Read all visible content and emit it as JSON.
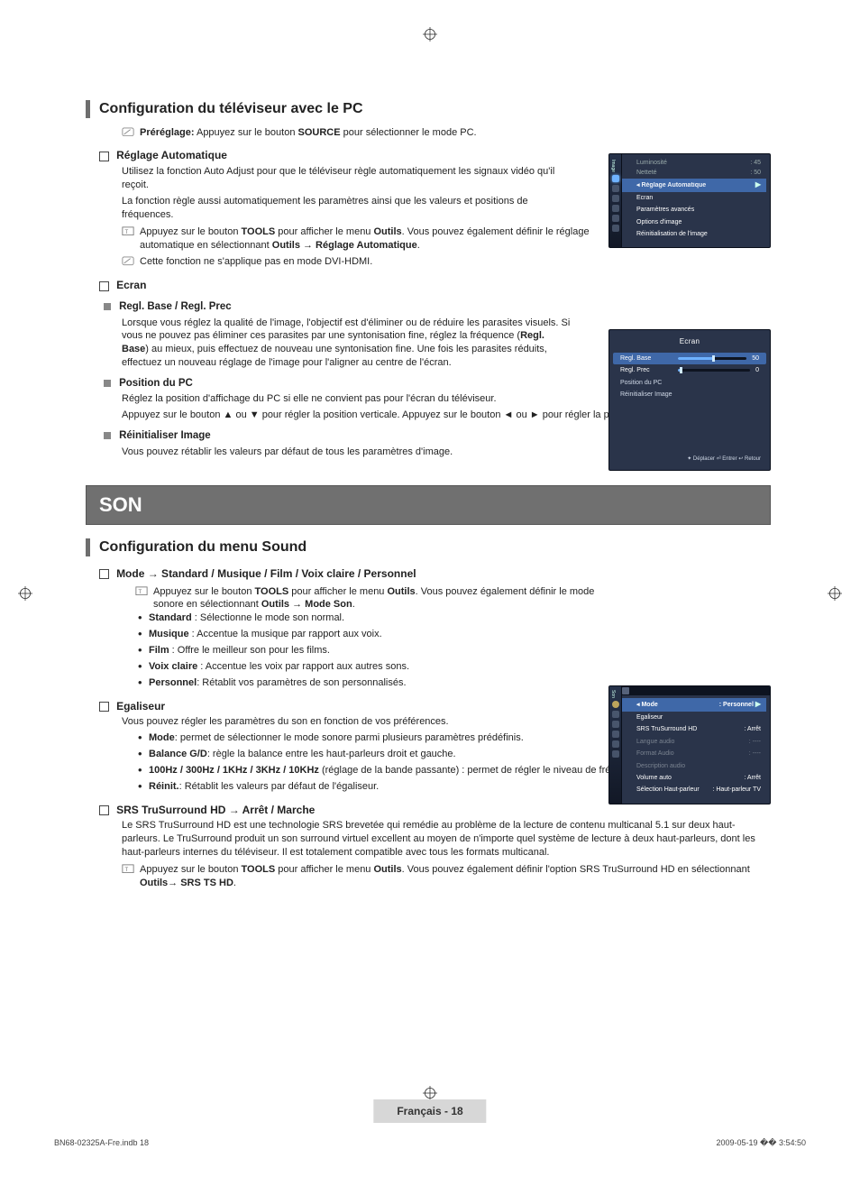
{
  "registration": "⊕",
  "header": {
    "main_title": "Configuration du téléviseur avec le PC",
    "prereg_label": "Préréglage:",
    "prereg_text_a": " Appuyez sur le bouton ",
    "prereg_source": "SOURCE",
    "prereg_text_b": " pour sélectionner le mode PC."
  },
  "reglage_auto": {
    "title": "Réglage Automatique",
    "p1": "Utilisez la fonction Auto Adjust pour que le téléviseur règle automatiquement les signaux vidéo qu'il reçoit.",
    "p2": "La fonction règle aussi automatiquement les paramètres ainsi que les valeurs et positions de fréquences.",
    "tools_a": "Appuyez sur le bouton ",
    "tools_bold1": "TOOLS",
    "tools_b": " pour afficher le menu ",
    "tools_bold2": "Outils",
    "tools_c": ". Vous pouvez également définir le réglage automatique en sélectionnant ",
    "tools_bold3": "Outils → Réglage Automatique",
    "tools_d": ".",
    "note_dvi": "Cette fonction ne s'applique pas en mode DVI-HDMI."
  },
  "ecran": {
    "title": "Ecran",
    "regl": {
      "title": "Regl. Base / Regl. Prec",
      "p_a": "Lorsque vous réglez la qualité de l'image, l'objectif est d'éliminer ou de réduire les parasites visuels. Si vous ne pouvez pas éliminer ces parasites par une syntonisation fine, réglez la fréquence (",
      "p_bold": "Regl. Base",
      "p_b": ") au mieux, puis effectuez de nouveau une syntonisation fine. Une fois les parasites réduits, effectuez un nouveau réglage de l'image pour l'aligner au centre de l'écran."
    },
    "pos": {
      "title": "Position du PC",
      "p1": "Réglez la position d'affichage du PC si elle ne convient pas pour l'écran du téléviseur.",
      "p2": "Appuyez sur le bouton ▲ ou ▼ pour régler la position verticale. Appuyez sur le bouton ◄ ou ► pour régler la position horizontale."
    },
    "reinit": {
      "title": "Réinitialiser Image",
      "p": "Vous pouvez rétablir les valeurs par défaut de tous les paramètres d'image."
    }
  },
  "son_banner": "SON",
  "sound": {
    "title": "Configuration du menu Sound",
    "mode": {
      "title": "Mode → Standard / Musique / Film / Voix claire / Personnel",
      "tools_a": "Appuyez sur le bouton ",
      "tools_bold1": "TOOLS",
      "tools_b": " pour afficher le menu ",
      "tools_bold2": "Outils",
      "tools_c": ". Vous pouvez également définir le mode sonore en sélectionnant ",
      "tools_bold3": "Outils → Mode Son",
      "tools_d": ".",
      "items": [
        {
          "b": "Standard",
          "t": " : Sélectionne le mode son normal."
        },
        {
          "b": "Musique",
          "t": " : Accentue la musique par rapport aux voix."
        },
        {
          "b": "Film",
          "t": " : Offre le meilleur son pour les films."
        },
        {
          "b": "Voix claire",
          "t": " : Accentue les voix par rapport aux autres sons."
        },
        {
          "b": "Personnel",
          "t": ": Rétablit vos paramètres de son personnalisés."
        }
      ]
    },
    "eq": {
      "title": "Egaliseur",
      "p": "Vous pouvez régler les paramètres du son en fonction de vos préférences.",
      "items": [
        {
          "b": "Mode",
          "t": ": permet de sélectionner le mode sonore parmi plusieurs paramètres prédéfinis."
        },
        {
          "b": "Balance G/D",
          "t": ": règle la balance entre les haut-parleurs droit et gauche."
        },
        {
          "b": "100Hz / 300Hz / 1KHz / 3KHz / 10KHz",
          "t": " (réglage de la bande passante) : permet de régler le niveau de fréquences de la bande passante."
        },
        {
          "b": "Réinit.",
          "t": ": Rétablit les valeurs par défaut de l'égaliseur."
        }
      ]
    },
    "srs": {
      "title": "SRS TruSurround HD → Arrêt / Marche",
      "p": "Le SRS TruSurround HD est une technologie SRS brevetée qui remédie au problème de la lecture de contenu multicanal 5.1 sur deux haut-parleurs. Le TruSurround produit un son surround virtuel excellent au moyen de n'importe quel système de lecture à deux haut-parleurs, dont les haut-parleurs internes du téléviseur. Il est totalement compatible avec tous les formats multicanal.",
      "tools_a": "Appuyez sur le bouton ",
      "tools_bold1": "TOOLS",
      "tools_b": " pour afficher le menu ",
      "tools_bold2": "Outils",
      "tools_c": ". Vous pouvez également définir l'option SRS TruSurround HD en sélectionnant ",
      "tools_bold3": "Outils→ SRS TS HD",
      "tools_d": "."
    }
  },
  "shot1": {
    "lum_l": "Luminosité",
    "lum_v": ": 45",
    "net_l": "Netteté",
    "net_v": ": 50",
    "hl": "Réglage Automatique",
    "m1": "Ecran",
    "m2": "Paramètres avancés",
    "m3": "Options d'image",
    "m4": "Réinitialisation de l'image"
  },
  "shot2": {
    "title": "Ecran",
    "r1": "Regl. Base",
    "r1v": "50",
    "r2": "Regl. Prec",
    "r2v": "0",
    "r3": "Position du PC",
    "r4": "Réinitialiser Image",
    "hints": "✦ Déplacer   ⏎ Entrer   ↩ Retour"
  },
  "shot3": {
    "mode_l": "Mode",
    "mode_v": ": Personnel",
    "m1": "Egaliseur",
    "m2l": "SRS TruSurround HD",
    "m2v": ": Arrêt",
    "m3l": "Langue audio",
    "m3v": ": ----",
    "m4l": "Format Audio",
    "m4v": ": ----",
    "m5": "Description audio",
    "m6l": "Volume auto",
    "m6v": ": Arrêt",
    "m7l": "Sélection Haut-parleur",
    "m7v": ": Haut-parleur TV"
  },
  "footer": {
    "page": "Français - 18",
    "left": "BN68-02325A-Fre.indb   18",
    "right": "2009-05-19   �� 3:54:50"
  }
}
